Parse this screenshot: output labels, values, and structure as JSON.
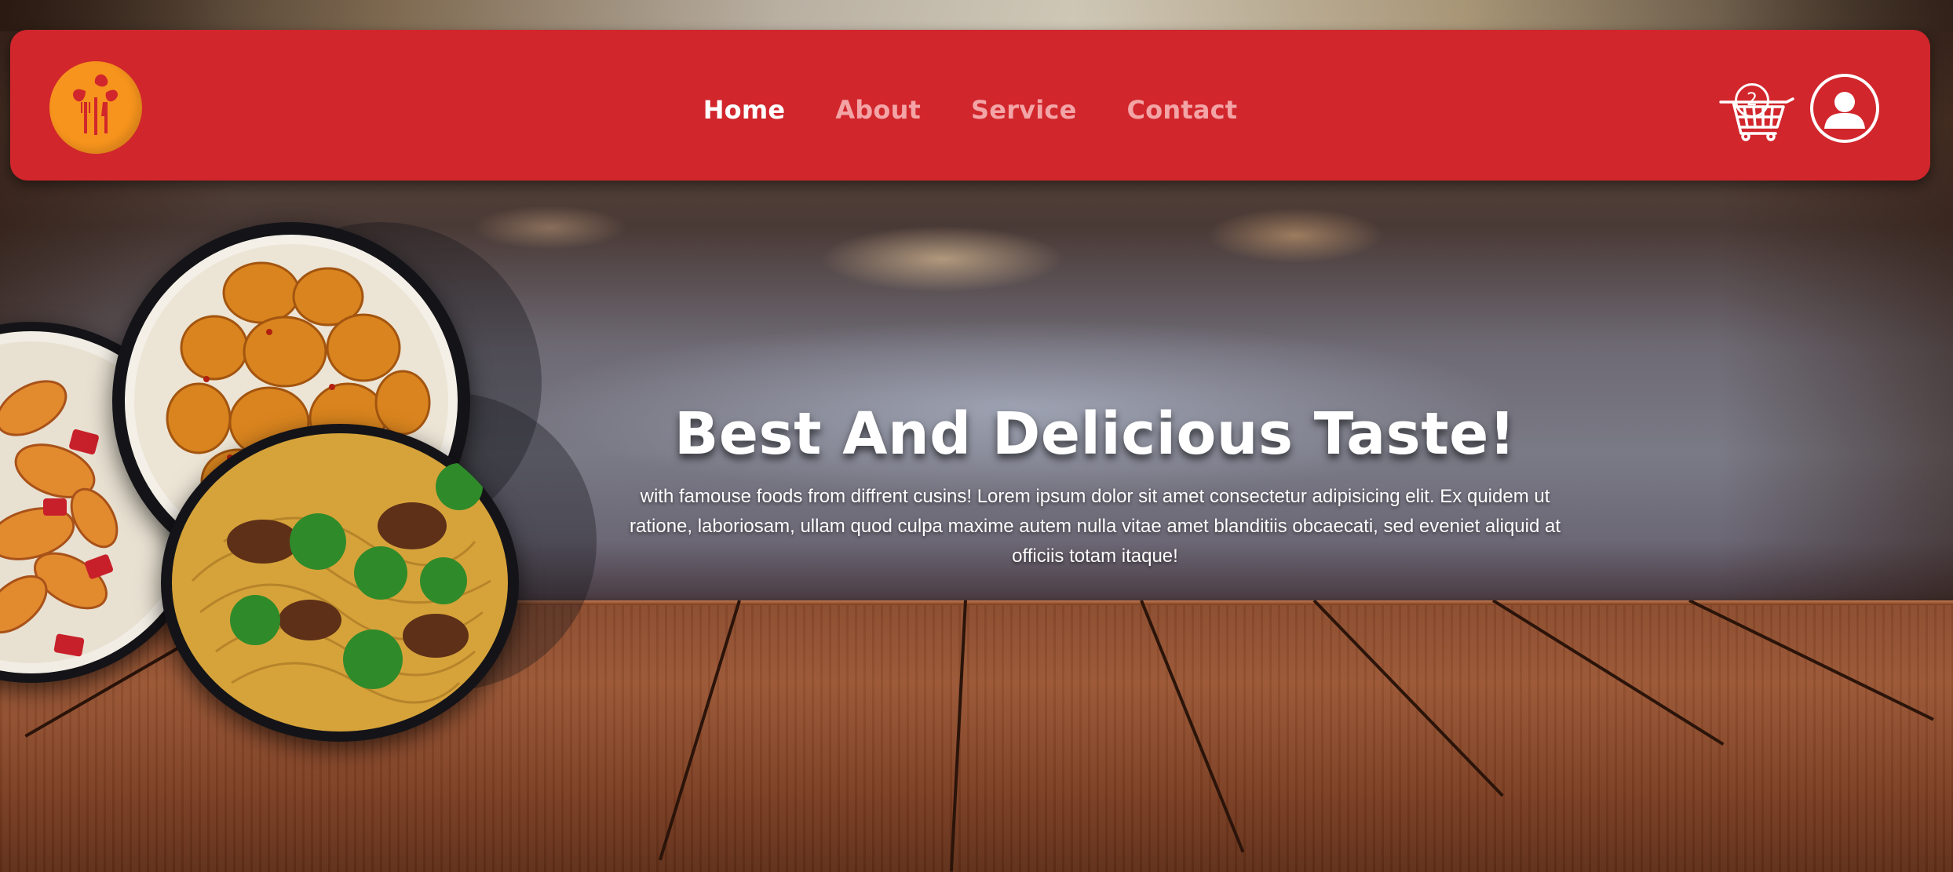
{
  "nav": {
    "items": [
      {
        "label": "Home",
        "active": true
      },
      {
        "label": "About",
        "active": false
      },
      {
        "label": "Service",
        "active": false
      },
      {
        "label": "Contact",
        "active": false
      }
    ]
  },
  "header": {
    "logo_icon": "leaf-fork-knife-logo",
    "cart_icon": "shopping-cart-icon",
    "cart_count": "2",
    "account_icon": "user-avatar-icon"
  },
  "hero": {
    "title": "Best And Delicious Taste!",
    "description": "with famouse foods from diffrent cusins! Lorem ipsum dolor sit amet consectetur adipisicing elit. Ex quidem ut ratione, laboriosam, ullam quod culpa maxime autem nulla vitae amet blanditiis obcaecati, sed eveniet aliquid at officiis totam itaque!"
  },
  "colors": {
    "header": "#d1262c",
    "logo": "#f7941d",
    "nav_active": "#ffffff",
    "nav_inactive": "#f3a4a6"
  }
}
